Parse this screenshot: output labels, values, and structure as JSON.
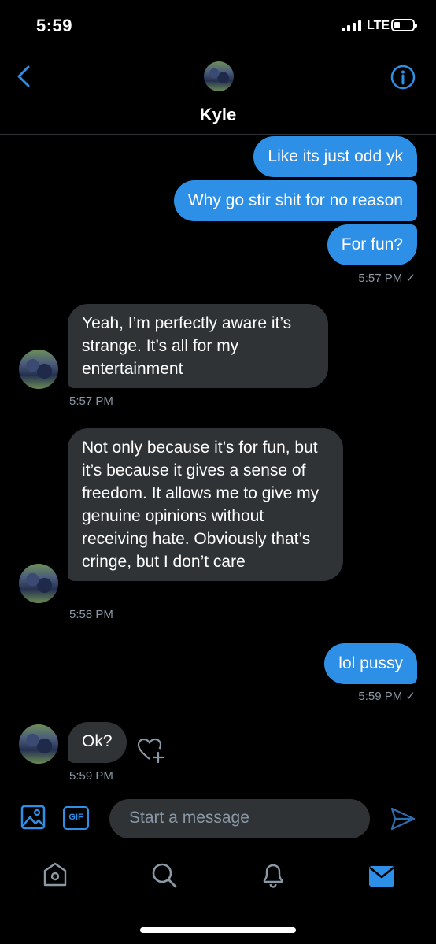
{
  "status_bar": {
    "time": "5:59",
    "network": "LTE"
  },
  "header": {
    "contact_name": "Kyle"
  },
  "messages": [
    {
      "dir": "out",
      "text": "Like its just odd yk"
    },
    {
      "dir": "out",
      "text": "Why go stir shit for no reason"
    },
    {
      "dir": "out",
      "text": "For fun?"
    },
    {
      "dir": "out",
      "timestamp": "5:57 PM ✓"
    },
    {
      "dir": "in",
      "text": "Yeah, I’m perfectly aware it’s strange. It’s all for my entertainment",
      "timestamp": "5:57 PM"
    },
    {
      "dir": "in",
      "text": "Not only because it’s for fun, but it’s because it gives a sense of freedom. It allows me to give my genuine opinions without receiving hate. Obviously that’s cringe, but I don’t care",
      "timestamp": "5:58 PM"
    },
    {
      "dir": "out",
      "text": "lol pussy",
      "timestamp": "5:59 PM ✓"
    },
    {
      "dir": "in",
      "text": "Ok?",
      "timestamp": "5:59 PM"
    }
  ],
  "composer": {
    "placeholder": "Start a message",
    "gif_label": "GIF"
  },
  "icons": {
    "back": "chevron-left-icon",
    "info": "info-icon",
    "image": "image-icon",
    "send": "send-icon",
    "react": "heart-plus-icon",
    "home": "home-icon",
    "search": "search-icon",
    "notifications": "bell-icon",
    "messages": "mail-icon"
  },
  "colors": {
    "accent": "#2e8fe6",
    "incoming_bubble": "#2f3336",
    "timestamp": "#8b98a5"
  }
}
